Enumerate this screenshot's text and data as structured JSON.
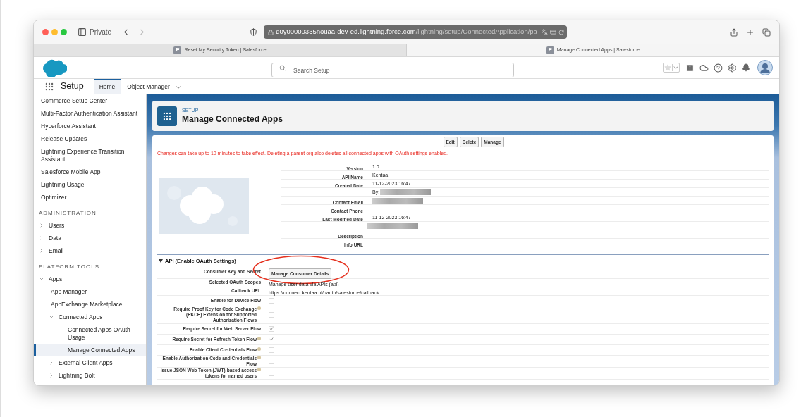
{
  "browser": {
    "private_label": "Private",
    "url_host": "d0y00000335nouaa-dev-ed.lightning.force.com",
    "url_path": "/lightning/setup/ConnectedApplication/pa",
    "tabs": [
      {
        "title": "Reset My Security Token | Salesforce",
        "favicon": "F",
        "selected": false
      },
      {
        "title": "Manage Connected Apps | Salesforce",
        "favicon": "F",
        "selected": true
      }
    ]
  },
  "header": {
    "search": {
      "placeholder": "Search Setup"
    }
  },
  "nav": {
    "app_name": "Setup",
    "tabs": [
      {
        "label": "Home",
        "selected": true,
        "dropdown": false
      },
      {
        "label": "Object Manager",
        "selected": false,
        "dropdown": true
      }
    ]
  },
  "sidebar": {
    "items": [
      {
        "kind": "link",
        "label": "Commerce Setup Center",
        "selected": false
      },
      {
        "kind": "link",
        "label": "Multi-Factor Authentication Assistant",
        "selected": false
      },
      {
        "kind": "link",
        "label": "Hyperforce Assistant",
        "selected": false
      },
      {
        "kind": "link",
        "label": "Release Updates",
        "selected": false
      },
      {
        "kind": "link",
        "label": "Lightning Experience Transition Assistant",
        "selected": false
      },
      {
        "kind": "link",
        "label": "Salesforce Mobile App",
        "selected": false
      },
      {
        "kind": "link",
        "label": "Lightning Usage",
        "selected": false
      },
      {
        "kind": "link",
        "label": "Optimizer",
        "selected": false
      },
      {
        "kind": "heading",
        "label": "ADMINISTRATION"
      },
      {
        "kind": "group",
        "label": "Users",
        "expanded": false
      },
      {
        "kind": "group",
        "label": "Data",
        "expanded": false
      },
      {
        "kind": "group",
        "label": "Email",
        "expanded": false
      },
      {
        "kind": "heading",
        "label": "PLATFORM TOOLS"
      },
      {
        "kind": "group",
        "label": "Apps",
        "expanded": true,
        "children": [
          {
            "kind": "link",
            "label": "App Manager",
            "selected": false
          },
          {
            "kind": "link",
            "label": "AppExchange Marketplace",
            "selected": false
          },
          {
            "kind": "group",
            "label": "Connected Apps",
            "expanded": true,
            "children": [
              {
                "kind": "link",
                "label": "Connected Apps OAuth Usage",
                "selected": false
              },
              {
                "kind": "link",
                "label": "Manage Connected Apps",
                "selected": true
              }
            ]
          },
          {
            "kind": "group",
            "label": "External Client Apps",
            "expanded": false
          },
          {
            "kind": "group",
            "label": "Lightning Bolt",
            "expanded": false
          }
        ]
      }
    ]
  },
  "page_header": {
    "eyebrow": "SETUP",
    "title": "Manage Connected Apps"
  },
  "detail": {
    "buttons": [
      "Edit",
      "Delete",
      "Manage"
    ],
    "warning": "Changes can take up to 10 minutes to take effect. Deleting a parent org also deletes all connected apps with OAuth settings enabled.",
    "fields": [
      {
        "label": "Version",
        "value": "1.0",
        "redacted": false
      },
      {
        "label": "API Name",
        "value": "Kentaa",
        "redacted": false
      },
      {
        "label": "Created Date",
        "value": "11-12-2023 16:47",
        "redacted": false
      },
      {
        "value": "By:",
        "redacted": true
      },
      {
        "label": "Contact Email",
        "redacted": true
      },
      {
        "label": "Contact Phone",
        "redacted": false
      },
      {
        "label": "Last Modified Date",
        "value": "11-12-2023 16:47",
        "redacted": false
      },
      {
        "redacted": true
      },
      {
        "label": "Description",
        "redacted": false
      },
      {
        "label": "Info URL",
        "redacted": false
      }
    ]
  },
  "oauth_section": {
    "title": "API (Enable OAuth Settings)",
    "expanded": true,
    "rows": [
      {
        "kind": "button",
        "label": "Consumer Key and Secret",
        "button": "Manage Consumer Details",
        "info": false,
        "circled": true
      },
      {
        "kind": "text",
        "label": "Selected OAuth Scopes",
        "value": "Manage user data via APIs (api)",
        "info": false,
        "circled": false
      },
      {
        "kind": "text",
        "label": "Callback URL",
        "value": "https://connect.kentaa.nl/oauth/salesforce/callback",
        "info": false,
        "circled": false
      },
      {
        "kind": "checkbox",
        "label": "Enable for Device Flow",
        "checked": false,
        "info": false,
        "circled": false
      },
      {
        "kind": "checkbox",
        "label": "Require Proof Key for Code Exchange (PKCE) Extension for Supported Authorization Flows",
        "checked": false,
        "info": true,
        "circled": false
      },
      {
        "kind": "checkbox",
        "label": "Require Secret for Web Server Flow",
        "checked": true,
        "info": false,
        "circled": false
      },
      {
        "kind": "checkbox",
        "label": "Require Secret for Refresh Token Flow",
        "checked": true,
        "info": true,
        "circled": false
      },
      {
        "kind": "checkbox",
        "label": "Enable Client Credentials Flow",
        "checked": false,
        "info": true,
        "circled": false
      },
      {
        "kind": "checkbox",
        "label": "Enable Authorization Code and Credentials Flow",
        "checked": false,
        "info": true,
        "circled": false
      },
      {
        "kind": "checkbox",
        "label": "Issue JSON Web Token (JWT)-based access tokens for named users",
        "checked": false,
        "info": true,
        "circled": false
      }
    ]
  }
}
